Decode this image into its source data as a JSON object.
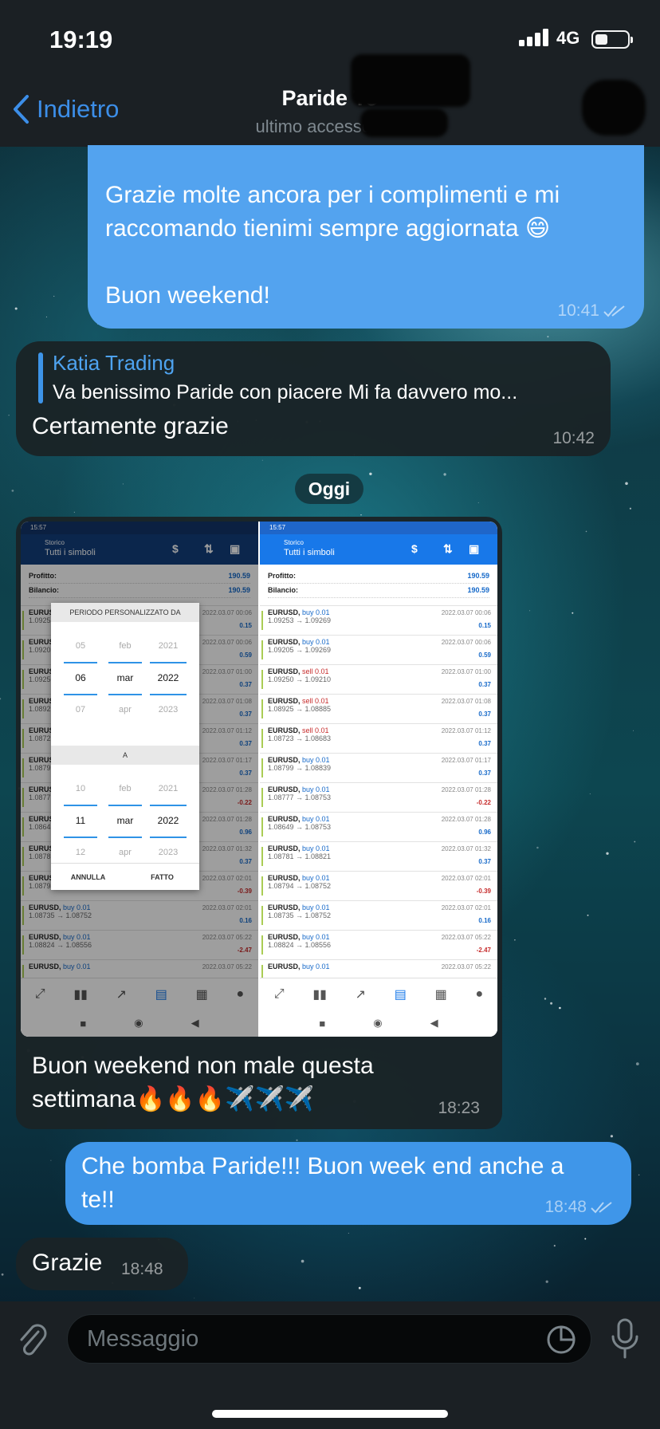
{
  "status_bar": {
    "time": "19:19",
    "network": "4G"
  },
  "header": {
    "back_label": "Indietro",
    "contact_name": "Paride To",
    "last_seen": "ultimo accesso di       e"
  },
  "messages": [
    {
      "id": "m1",
      "direction": "outgoing",
      "lines": [
        "Grazie molte ancora per i complimenti e mi",
        "raccomando tienimi sempre aggiornata 😄",
        "",
        "Buon weekend!"
      ],
      "time": "10:41",
      "read": true
    },
    {
      "id": "m2",
      "direction": "incoming",
      "reply_to": {
        "author": "Katia Trading",
        "text": "Va benissimo Paride con piacere  Mi fa davvero mo..."
      },
      "text": "Certamente grazie",
      "time": "10:42"
    },
    {
      "id": "m3",
      "direction": "incoming",
      "has_image": true,
      "lines": [
        "Buon weekend non male questa",
        "settimana🔥🔥🔥✈️✈️✈️"
      ],
      "time": "18:23"
    },
    {
      "id": "m4",
      "direction": "outgoing",
      "lines": [
        "Che bomba Paride!!! Buon week end anche a",
        "te!!"
      ],
      "time": "18:48",
      "read": true
    },
    {
      "id": "m5",
      "direction": "incoming",
      "text": "Grazie",
      "time": "18:48"
    }
  ],
  "date_separator": "Oggi",
  "screenshot": {
    "time": "15:57",
    "title_small": "Storico",
    "title": "Tutti i simboli",
    "profit_label": "Profitto:",
    "profit_value": "190.59",
    "balance_label": "Bilancio:",
    "balance_value": "190.59",
    "dialog": {
      "header": "PERIODO PERSONALIZZATO DA",
      "separator": "A",
      "from": {
        "day": [
          "05",
          "06",
          "07"
        ],
        "month": [
          "feb",
          "mar",
          "apr"
        ],
        "year": [
          "2021",
          "2022",
          "2023"
        ]
      },
      "to": {
        "day": [
          "10",
          "11",
          "12"
        ],
        "month": [
          "feb",
          "mar",
          "apr"
        ],
        "year": [
          "2021",
          "2022",
          "2023"
        ]
      },
      "cancel": "ANNULLA",
      "done": "FATTO"
    },
    "trades": [
      {
        "sym": "EURUSD,",
        "side": "buy 0.01",
        "prices": "1.09253 → 1.09269",
        "date": "2022.03.07 00:06",
        "profit": "0.15"
      },
      {
        "sym": "EURUSD,",
        "side": "buy 0.01",
        "prices": "1.09205 → 1.09269",
        "date": "2022.03.07 00:06",
        "profit": "0.59"
      },
      {
        "sym": "EURUSD,",
        "side": "sell 0.01",
        "prices": "1.09250 → 1.09210",
        "date": "2022.03.07 01:00",
        "profit": "0.37"
      },
      {
        "sym": "EURUSD,",
        "side": "sell 0.01",
        "prices": "1.08925 → 1.08885",
        "date": "2022.03.07 01:08",
        "profit": "0.37"
      },
      {
        "sym": "EURUSD,",
        "side": "sell 0.01",
        "prices": "1.08723 → 1.08683",
        "date": "2022.03.07 01:12",
        "profit": "0.37"
      },
      {
        "sym": "EURUSD,",
        "side": "buy 0.01",
        "prices": "1.08799 → 1.08839",
        "date": "2022.03.07 01:17",
        "profit": "0.37"
      },
      {
        "sym": "EURUSD,",
        "side": "buy 0.01",
        "prices": "1.08777 → 1.08753",
        "date": "2022.03.07 01:28",
        "profit": "-0.22"
      },
      {
        "sym": "EURUSD,",
        "side": "buy 0.01",
        "prices": "1.08649 → 1.08753",
        "date": "2022.03.07 01:28",
        "profit": "0.96"
      },
      {
        "sym": "EURUSD,",
        "side": "buy 0.01",
        "prices": "1.08781 → 1.08821",
        "date": "2022.03.07 01:32",
        "profit": "0.37"
      },
      {
        "sym": "EURUSD,",
        "side": "buy 0.01",
        "prices": "1.08794 → 1.08752",
        "date": "2022.03.07 02:01",
        "profit": "-0.39"
      },
      {
        "sym": "EURUSD,",
        "side": "buy 0.01",
        "prices": "1.08735 → 1.08752",
        "date": "2022.03.07 02:01",
        "profit": "0.16"
      },
      {
        "sym": "EURUSD,",
        "side": "buy 0.01",
        "prices": "1.08824 → 1.08556",
        "date": "2022.03.07 05:22",
        "profit": "-2.47"
      },
      {
        "sym": "EURUSD,",
        "side": "buy 0.01",
        "prices": "",
        "date": "2022.03.07 05:22",
        "profit": ""
      }
    ]
  },
  "composer": {
    "placeholder": "Messaggio"
  },
  "colors": {
    "outgoing_bubble": "#3f96e9",
    "incoming_bubble": "#1a2327",
    "accent": "#3c8ee8"
  }
}
